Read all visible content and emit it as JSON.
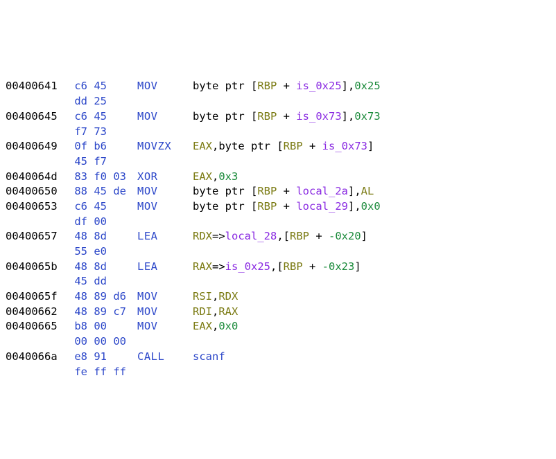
{
  "chart_data": null,
  "colors": {
    "addr": "#000000",
    "hex": "#2c47c9",
    "mnemonic": "#2c47c9",
    "register": "#7a7a12",
    "variable": "#8a2be2",
    "number": "#1a8a3a",
    "function": "#2c47c9"
  },
  "rows": [
    {
      "addr": "00400641",
      "hex_lines": [
        "c6 45",
        "dd 25"
      ],
      "mn": "MOV",
      "ops": [
        {
          "t": "txt",
          "v": "byte ptr ["
        },
        {
          "t": "reg",
          "v": "RBP"
        },
        {
          "t": "txt",
          "v": " + "
        },
        {
          "t": "var",
          "v": "is_0x25"
        },
        {
          "t": "txt",
          "v": "],"
        },
        {
          "t": "num",
          "v": "0x25"
        }
      ]
    },
    {
      "addr": "00400645",
      "hex_lines": [
        "c6 45",
        "f7 73"
      ],
      "mn": "MOV",
      "ops": [
        {
          "t": "txt",
          "v": "byte ptr ["
        },
        {
          "t": "reg",
          "v": "RBP"
        },
        {
          "t": "txt",
          "v": " + "
        },
        {
          "t": "var",
          "v": "is_0x73"
        },
        {
          "t": "txt",
          "v": "],"
        },
        {
          "t": "num",
          "v": "0x73"
        }
      ]
    },
    {
      "addr": "00400649",
      "hex_lines": [
        "0f b6",
        "45 f7"
      ],
      "mn": "MOVZX",
      "ops": [
        {
          "t": "reg",
          "v": "EAX"
        },
        {
          "t": "txt",
          "v": ",byte ptr ["
        },
        {
          "t": "reg",
          "v": "RBP"
        },
        {
          "t": "txt",
          "v": " + "
        },
        {
          "t": "var",
          "v": "is_0x73"
        },
        {
          "t": "txt",
          "v": "]"
        }
      ]
    },
    {
      "addr": "0040064d",
      "hex_lines": [
        "83 f0 03"
      ],
      "mn": "XOR",
      "ops": [
        {
          "t": "reg",
          "v": "EAX"
        },
        {
          "t": "txt",
          "v": ","
        },
        {
          "t": "num",
          "v": "0x3"
        }
      ]
    },
    {
      "addr": "00400650",
      "hex_lines": [
        "88 45 de"
      ],
      "mn": "MOV",
      "ops": [
        {
          "t": "txt",
          "v": "byte ptr ["
        },
        {
          "t": "reg",
          "v": "RBP"
        },
        {
          "t": "txt",
          "v": " + "
        },
        {
          "t": "var",
          "v": "local_2a"
        },
        {
          "t": "txt",
          "v": "],"
        },
        {
          "t": "reg",
          "v": "AL"
        }
      ]
    },
    {
      "addr": "00400653",
      "hex_lines": [
        "c6 45",
        "df 00"
      ],
      "mn": "MOV",
      "ops": [
        {
          "t": "txt",
          "v": "byte ptr ["
        },
        {
          "t": "reg",
          "v": "RBP"
        },
        {
          "t": "txt",
          "v": " + "
        },
        {
          "t": "var",
          "v": "local_29"
        },
        {
          "t": "txt",
          "v": "],"
        },
        {
          "t": "num",
          "v": "0x0"
        }
      ]
    },
    {
      "addr": "00400657",
      "hex_lines": [
        "48 8d",
        "55 e0"
      ],
      "mn": "LEA",
      "ops": [
        {
          "t": "reg",
          "v": "RDX"
        },
        {
          "t": "txt",
          "v": "=>"
        },
        {
          "t": "var",
          "v": "local_28"
        },
        {
          "t": "txt",
          "v": ",["
        },
        {
          "t": "reg",
          "v": "RBP"
        },
        {
          "t": "txt",
          "v": " + "
        },
        {
          "t": "num",
          "v": "-0x20"
        },
        {
          "t": "txt",
          "v": "]"
        }
      ]
    },
    {
      "addr": "0040065b",
      "hex_lines": [
        "48 8d",
        "45 dd"
      ],
      "mn": "LEA",
      "ops": [
        {
          "t": "reg",
          "v": "RAX"
        },
        {
          "t": "txt",
          "v": "=>"
        },
        {
          "t": "var",
          "v": "is_0x25"
        },
        {
          "t": "txt",
          "v": ",["
        },
        {
          "t": "reg",
          "v": "RBP"
        },
        {
          "t": "txt",
          "v": " + "
        },
        {
          "t": "num",
          "v": "-0x23"
        },
        {
          "t": "txt",
          "v": "]"
        }
      ]
    },
    {
      "addr": "0040065f",
      "hex_lines": [
        "48 89 d6"
      ],
      "mn": "MOV",
      "ops": [
        {
          "t": "reg",
          "v": "RSI"
        },
        {
          "t": "txt",
          "v": ","
        },
        {
          "t": "reg",
          "v": "RDX"
        }
      ]
    },
    {
      "addr": "00400662",
      "hex_lines": [
        "48 89 c7"
      ],
      "mn": "MOV",
      "ops": [
        {
          "t": "reg",
          "v": "RDI"
        },
        {
          "t": "txt",
          "v": ","
        },
        {
          "t": "reg",
          "v": "RAX"
        }
      ]
    },
    {
      "addr": "00400665",
      "hex_lines": [
        "b8 00",
        "00 00 00"
      ],
      "mn": "MOV",
      "ops": [
        {
          "t": "reg",
          "v": "EAX"
        },
        {
          "t": "txt",
          "v": ","
        },
        {
          "t": "num",
          "v": "0x0"
        }
      ]
    },
    {
      "addr": "0040066a",
      "hex_lines": [
        "e8 91",
        "fe ff ff"
      ],
      "mn": "CALL",
      "ops": [
        {
          "t": "fn",
          "v": "scanf"
        }
      ]
    }
  ]
}
